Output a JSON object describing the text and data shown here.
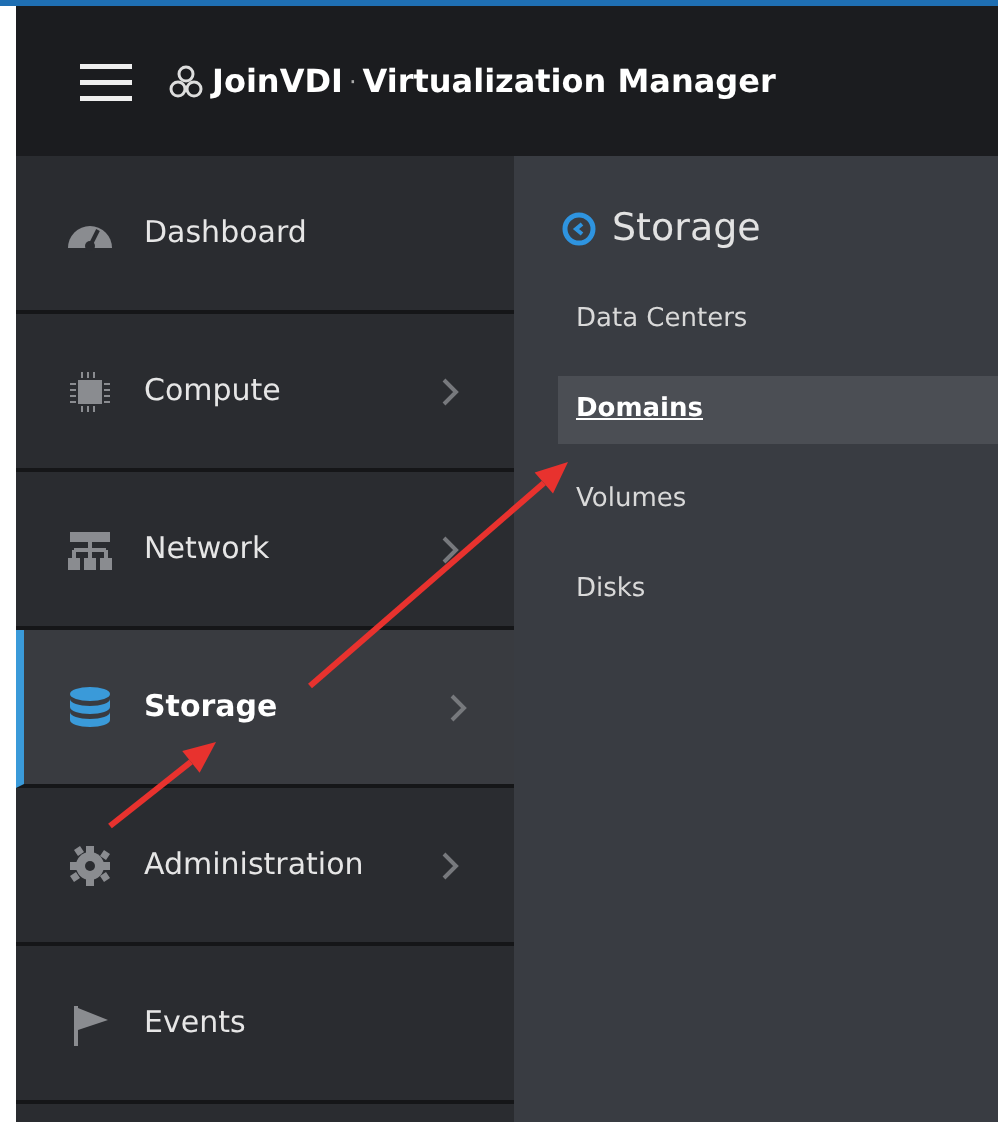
{
  "header": {
    "brand": "JoinVDI",
    "separator": "·",
    "product": "Virtualization Manager"
  },
  "sidebar": {
    "items": [
      {
        "label": "Dashboard",
        "kind": "gauge",
        "expandable": false,
        "selected": false
      },
      {
        "label": "Compute",
        "kind": "chip",
        "expandable": true,
        "selected": false
      },
      {
        "label": "Network",
        "kind": "network",
        "expandable": true,
        "selected": false
      },
      {
        "label": "Storage",
        "kind": "database",
        "expandable": true,
        "selected": true
      },
      {
        "label": "Administration",
        "kind": "gear",
        "expandable": true,
        "selected": false
      },
      {
        "label": "Events",
        "kind": "flag",
        "expandable": false,
        "selected": false
      }
    ]
  },
  "submenu": {
    "title": "Storage",
    "items": [
      {
        "label": "Data Centers",
        "selected": false
      },
      {
        "label": "Domains",
        "selected": true
      },
      {
        "label": "Volumes",
        "selected": false
      },
      {
        "label": "Disks",
        "selected": false
      }
    ]
  },
  "annotations": [
    {
      "kind": "arrow"
    },
    {
      "kind": "arrow"
    }
  ]
}
